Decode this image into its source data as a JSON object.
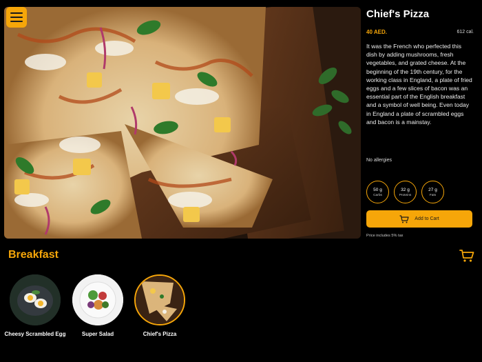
{
  "dish": {
    "title": "Chief's Pizza",
    "price": "40 AED.",
    "calories": "612 cal.",
    "description": "It was the French who perfected this dish by adding mushrooms, fresh vegetables, and grated cheese. At the beginning of the 19th century, for the working class in England, a plate of fried eggs and a few slices of bacon was an essential part of the English breakfast and a symbol of well being. Even today in England a plate of scrambled eggs and bacon is a mainstay.",
    "allergies": "No allergies",
    "nutrition": [
      {
        "value": "50 g",
        "label": "Carbs"
      },
      {
        "value": "32 g",
        "label": "Proteins"
      },
      {
        "value": "27 g",
        "label": "Fats"
      }
    ],
    "add_to_cart": "Add to Cart",
    "tax_note": "Price includes 5% tax"
  },
  "section": {
    "title": "Breakfast",
    "items": [
      {
        "label": "Cheesy Scrambled Egg",
        "selected": false
      },
      {
        "label": "Super Salad",
        "selected": false
      },
      {
        "label": "Chief's Pizza",
        "selected": true
      }
    ]
  },
  "colors": {
    "accent": "#f6a609",
    "background": "#000000"
  },
  "icons": {
    "menu": "hamburger-icon",
    "cart": "cart-icon"
  }
}
